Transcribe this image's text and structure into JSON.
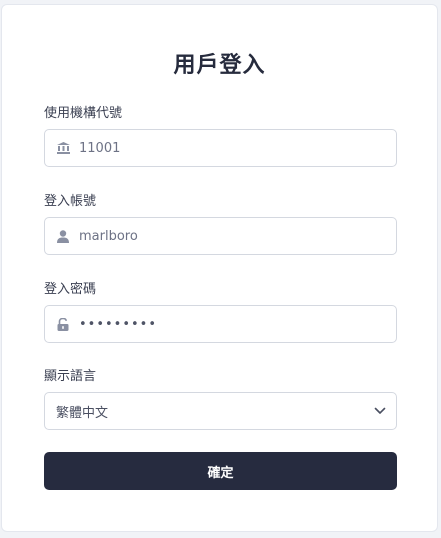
{
  "title": "用戶登入",
  "org_code": {
    "label": "使用機構代號",
    "value": "11001",
    "icon": "bank-icon"
  },
  "account": {
    "label": "登入帳號",
    "value": "marlboro",
    "icon": "user-icon"
  },
  "password": {
    "label": "登入密碼",
    "value": "•••••••••",
    "icon": "lock-icon"
  },
  "language": {
    "label": "顯示語言",
    "selected": "繁體中文",
    "icon": "chevron-down-icon"
  },
  "submit_label": "確定",
  "colors": {
    "primary_button": "#262b3f",
    "border": "#d4d8e0",
    "icon": "#8a90a2"
  }
}
